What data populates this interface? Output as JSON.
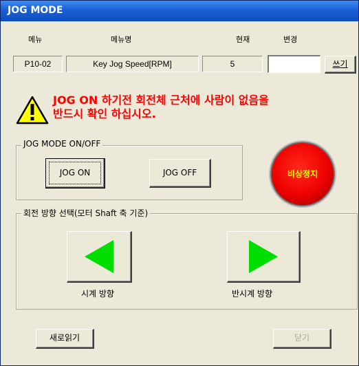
{
  "window": {
    "title": "JOG MODE"
  },
  "param_table": {
    "headers": {
      "menu": "메뉴",
      "menu_name": "메뉴명",
      "current": "현재",
      "change": "변경"
    },
    "row": {
      "code": "P10-02",
      "name": "Key Jog Speed[RPM]",
      "current_value": "5",
      "change_value": ""
    },
    "write_button": "쓰기"
  },
  "warning": {
    "icon": "warning-triangle-icon",
    "line1": "JOG ON 하기전 회전체 근처에 사람이 없음을",
    "line2": "반드시 확인 하십시오.",
    "color": "#ff0000"
  },
  "jog_group": {
    "label": "JOG MODE ON/OFF",
    "jog_on": "JOG ON",
    "jog_off": "JOG OFF"
  },
  "emergency_stop": {
    "label": "비상정지",
    "color": "#ee0000",
    "text_color": "#ffff00"
  },
  "direction_group": {
    "label": "회전 방향 선택(모터 Shaft 축 기준)",
    "cw_icon": "arrow-left-icon",
    "cw_label": "시계 방향",
    "ccw_icon": "arrow-right-icon",
    "ccw_label": "반시계 방향",
    "arrow_color": "#00dd00"
  },
  "footer": {
    "reload_button": "새로읽기",
    "close_button": "닫기",
    "close_enabled": false
  }
}
